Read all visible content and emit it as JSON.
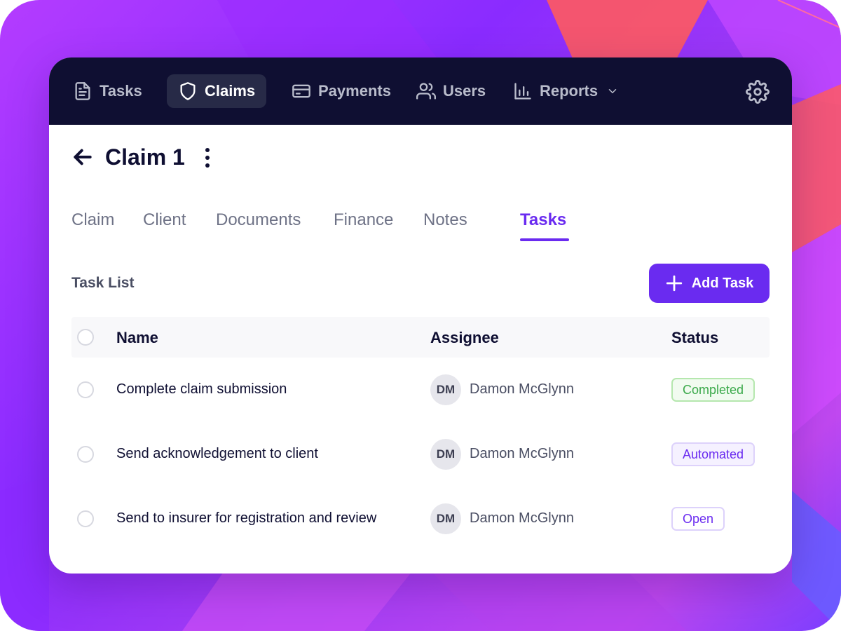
{
  "nav": {
    "items": [
      {
        "label": "Tasks",
        "icon": "file-text-icon"
      },
      {
        "label": "Claims",
        "icon": "shield-icon",
        "active": true
      },
      {
        "label": "Payments",
        "icon": "credit-card-icon"
      },
      {
        "label": "Users",
        "icon": "users-icon"
      },
      {
        "label": "Reports",
        "icon": "bar-chart-icon"
      }
    ],
    "settings_icon": "gear-icon"
  },
  "header": {
    "title": "Claim 1"
  },
  "tabs": [
    {
      "label": "Claim"
    },
    {
      "label": "Client"
    },
    {
      "label": "Documents"
    },
    {
      "label": "Finance"
    },
    {
      "label": "Notes"
    },
    {
      "label": "Tasks",
      "active": true
    }
  ],
  "task_list": {
    "title": "Task List",
    "add_button_label": "Add Task",
    "columns": {
      "name": "Name",
      "assignee": "Assignee",
      "status": "Status"
    },
    "rows": [
      {
        "name": "Complete claim submission",
        "assignee_initials": "DM",
        "assignee": "Damon McGlynn",
        "status": "Completed"
      },
      {
        "name": "Send acknowledgement to client",
        "assignee_initials": "DM",
        "assignee": "Damon McGlynn",
        "status": "Automated"
      },
      {
        "name": "Send to insurer for registration and review",
        "assignee_initials": "DM",
        "assignee": "Damon McGlynn",
        "status": "Open"
      }
    ]
  },
  "colors": {
    "accent": "#6a2bf0",
    "navbar": "#0f0f32",
    "completed": "#3aa94a"
  }
}
